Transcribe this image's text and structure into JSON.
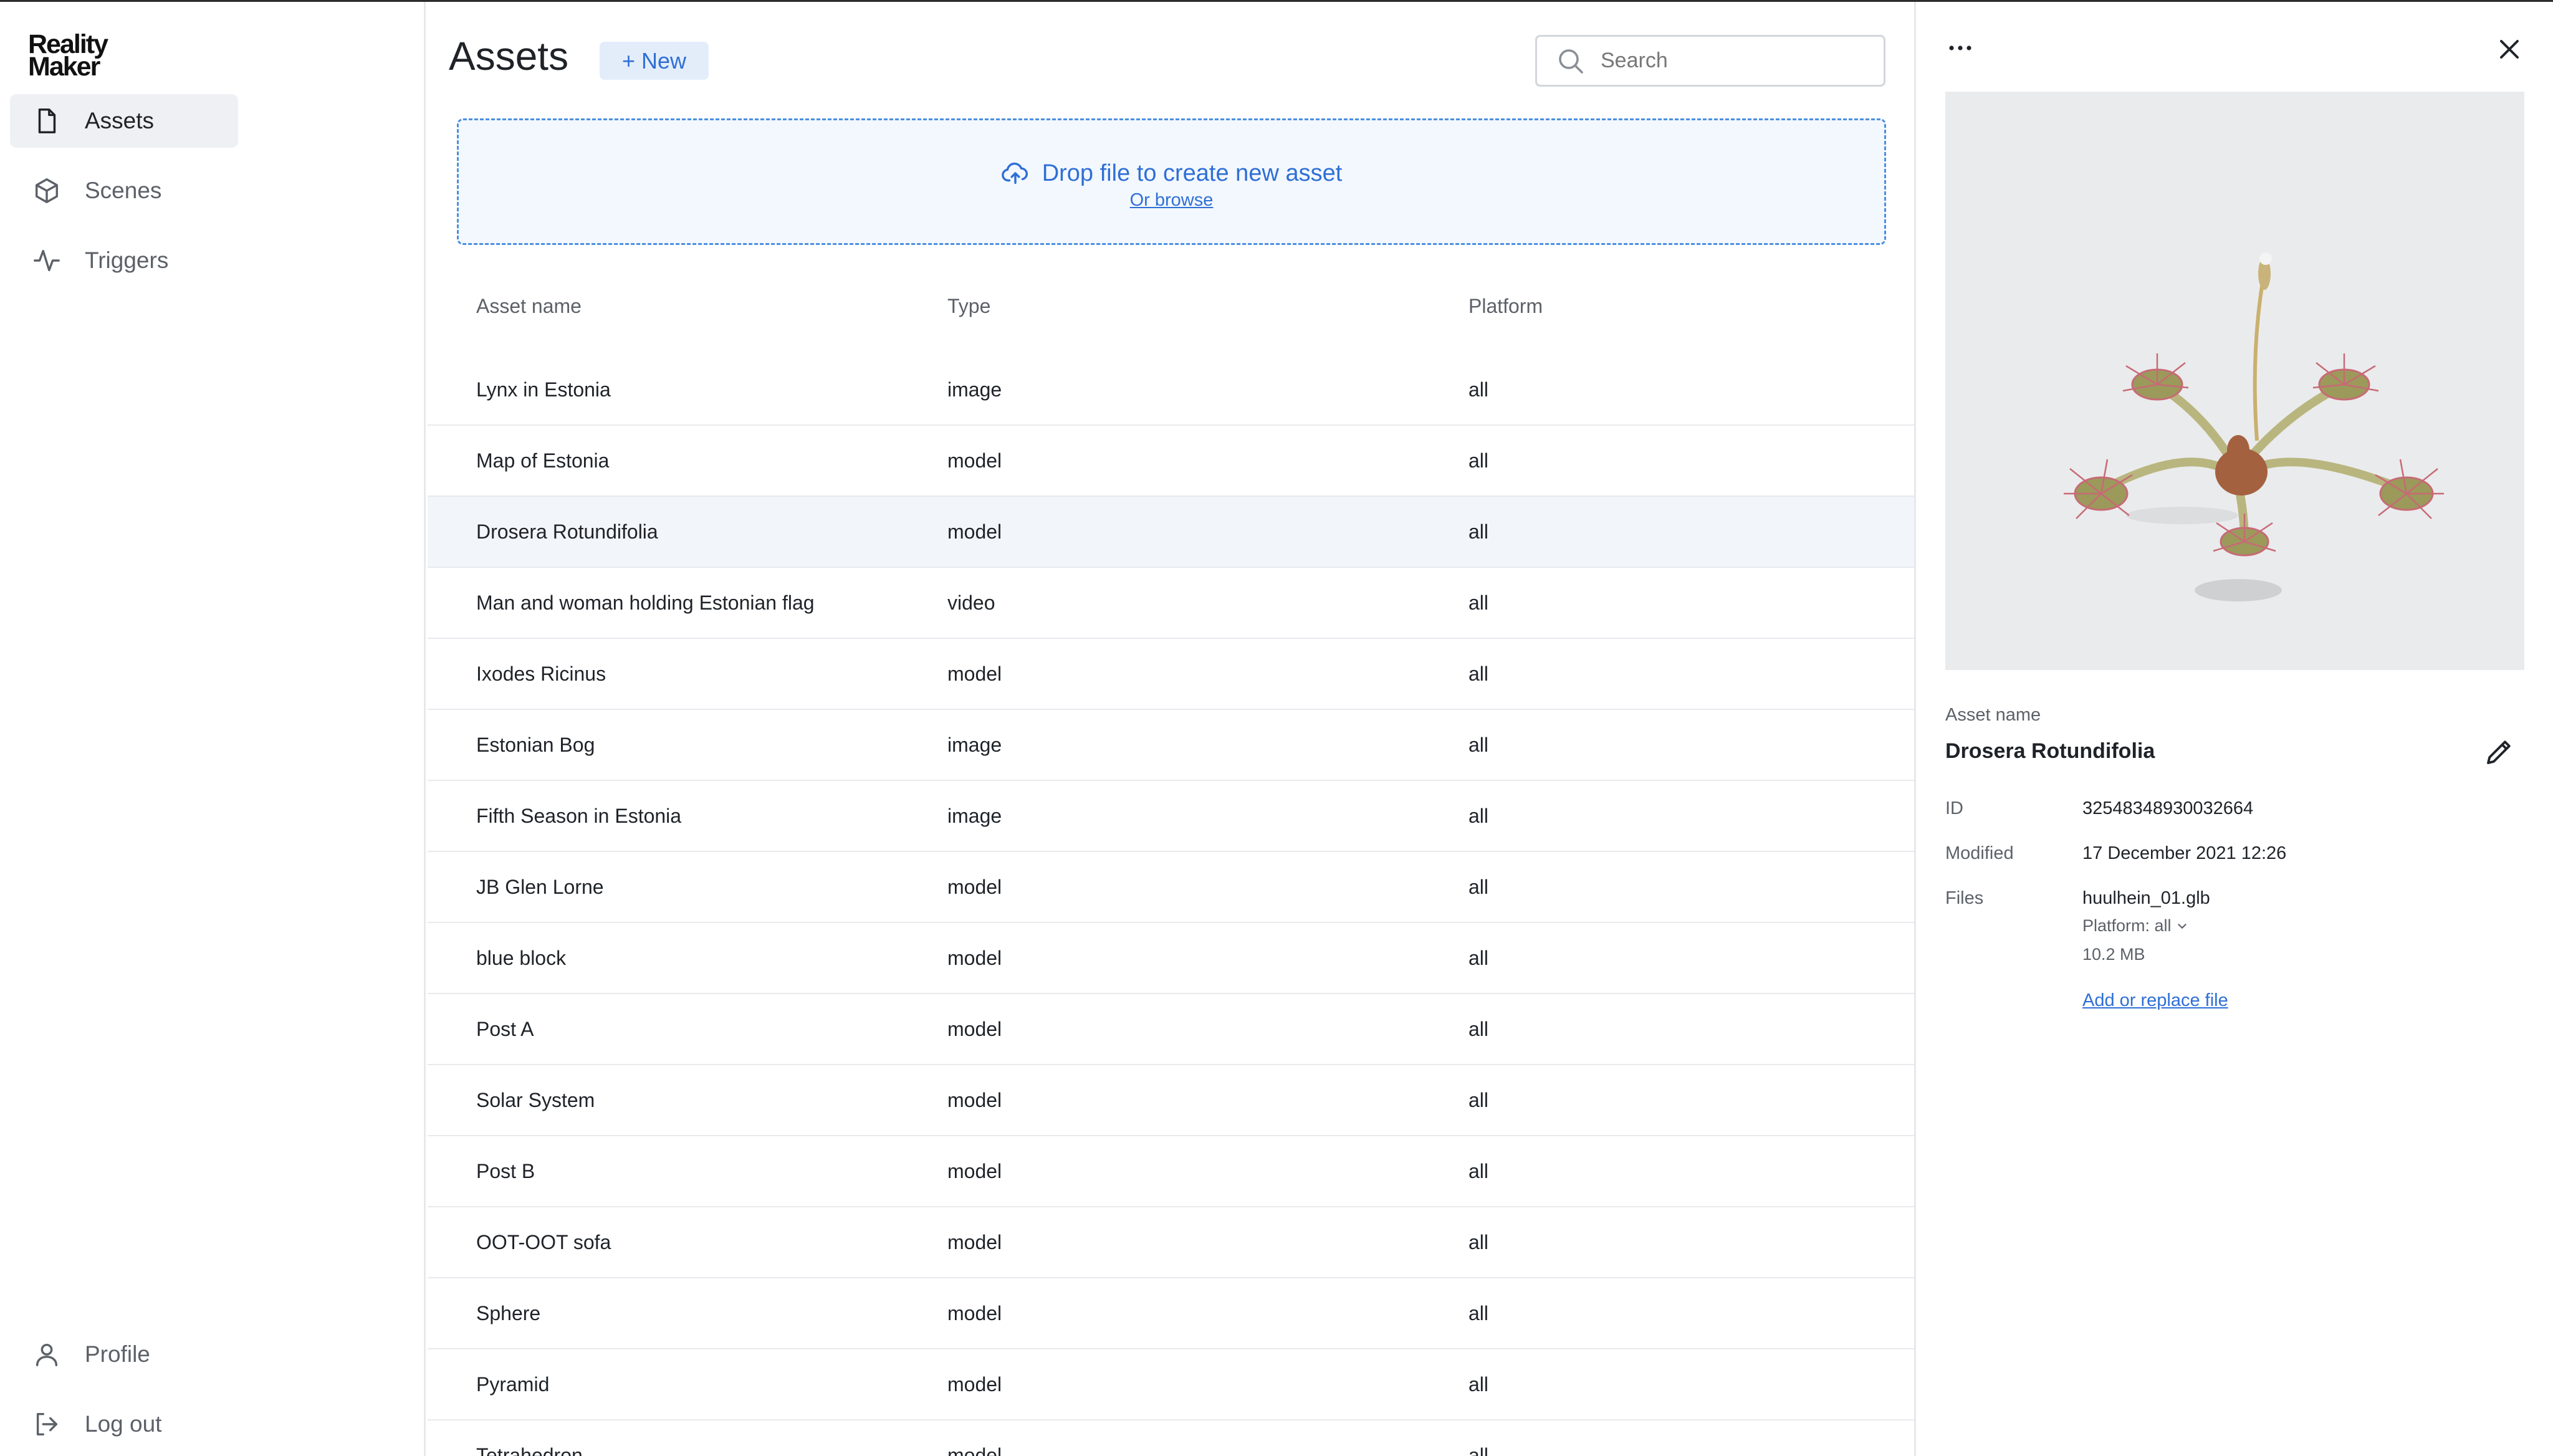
{
  "app": {
    "logo_line1": "Reality",
    "logo_line2": "Maker"
  },
  "sidebar": {
    "items": [
      {
        "label": "Assets",
        "icon": "file-icon",
        "active": true
      },
      {
        "label": "Scenes",
        "icon": "cube-icon",
        "active": false
      },
      {
        "label": "Triggers",
        "icon": "activity-icon",
        "active": false
      }
    ],
    "bottom": [
      {
        "label": "Profile",
        "icon": "user-icon"
      },
      {
        "label": "Log out",
        "icon": "logout-icon"
      }
    ]
  },
  "main": {
    "title": "Assets",
    "new_label": "+ New",
    "search_placeholder": "Search",
    "dropzone": {
      "text": "Drop file to create new asset",
      "link": "Or browse"
    },
    "columns": [
      "Asset name",
      "Type",
      "Platform"
    ],
    "rows": [
      {
        "name": "Lynx in Estonia",
        "type": "image",
        "platform": "all"
      },
      {
        "name": "Map of Estonia",
        "type": "model",
        "platform": "all"
      },
      {
        "name": "Drosera Rotundifolia",
        "type": "model",
        "platform": "all",
        "selected": true
      },
      {
        "name": "Man and woman holding Estonian flag",
        "type": "video",
        "platform": "all"
      },
      {
        "name": "Ixodes Ricinus",
        "type": "model",
        "platform": "all"
      },
      {
        "name": "Estonian Bog",
        "type": "image",
        "platform": "all"
      },
      {
        "name": "Fifth Season in Estonia",
        "type": "image",
        "platform": "all"
      },
      {
        "name": "JB Glen Lorne",
        "type": "model",
        "platform": "all"
      },
      {
        "name": "blue block",
        "type": "model",
        "platform": "all"
      },
      {
        "name": "Post A",
        "type": "model",
        "platform": "all"
      },
      {
        "name": "Solar System",
        "type": "model",
        "platform": "all"
      },
      {
        "name": "Post B",
        "type": "model",
        "platform": "all"
      },
      {
        "name": "OOT-OOT sofa",
        "type": "model",
        "platform": "all"
      },
      {
        "name": "Sphere",
        "type": "model",
        "platform": "all"
      },
      {
        "name": "Pyramid",
        "type": "model",
        "platform": "all"
      },
      {
        "name": "Tetrahedron",
        "type": "model",
        "platform": "all"
      }
    ]
  },
  "panel": {
    "asset_name_label": "Asset name",
    "asset_name": "Drosera Rotundifolia",
    "id_label": "ID",
    "id": "32548348930032664",
    "modified_label": "Modified",
    "modified": "17 December 2021 12:26",
    "files_label": "Files",
    "file_name": "huulhein_01.glb",
    "platform_label": "Platform: all",
    "file_size": "10.2 MB",
    "add_replace": "Add or replace file"
  },
  "colors": {
    "accent": "#2f6fd6",
    "selected_row": "#f2f6fb",
    "dropzone_bg": "#f3f8fe"
  }
}
